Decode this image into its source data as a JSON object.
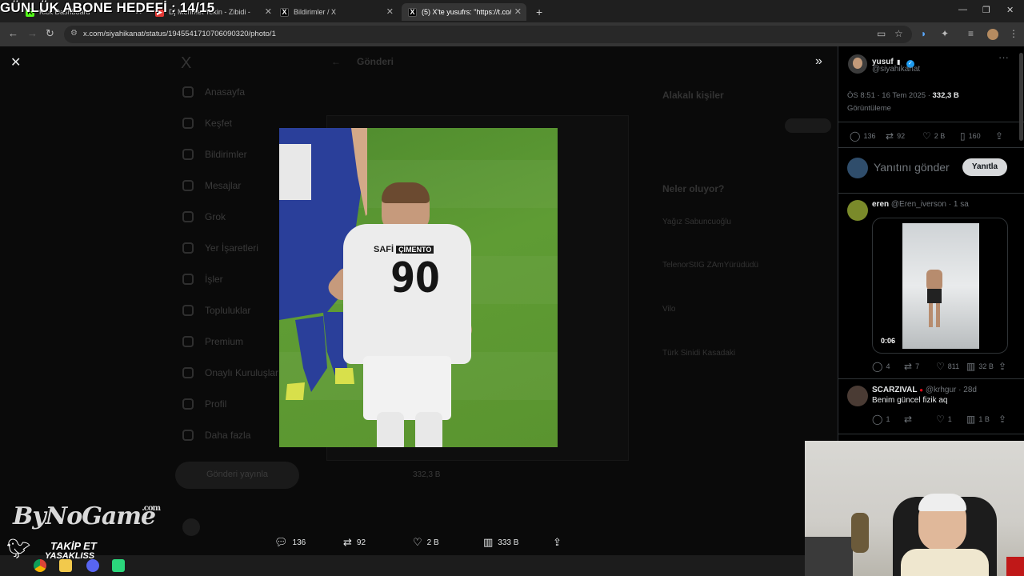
{
  "overlay": {
    "title": "GÜNLÜK ABONE HEDEFİ : 14/15",
    "brand": "ByNoGame",
    "brand_suffix": ".com",
    "follow": "TAKİP ET",
    "handle": "YASAKLISS"
  },
  "browser": {
    "tabs": [
      {
        "label": "Kick Dashboard",
        "active": false
      },
      {
        "label": "Dj Mehmet Tekin - Zibidi -",
        "active": false
      },
      {
        "label": "Bildirimler / X",
        "active": false
      },
      {
        "label": "(5) X'te yusufrs: \"https://t.co/...",
        "active": false
      }
    ],
    "url": "x.com/siyahikanat/status/1945541710706090320/photo/1"
  },
  "background_page": {
    "nav": [
      "Anasayfa",
      "Keşfet",
      "Bildirimler",
      "Mesajlar",
      "Grok",
      "Yer İşaretleri",
      "İşler",
      "Topluluklar",
      "Premium",
      "Onaylı Kuruluşlar",
      "Profil",
      "Daha fazla"
    ],
    "post_button": "Gönderi yayınla",
    "center_header": "Gönderi",
    "right_title": "Alakalı kişiler",
    "right_section": "Neler oluyor?",
    "trends": [
      "Yağız Sabuncuoğlu",
      "TelenorStIG ZAmYürüdüdü",
      "Vilo",
      "Türk Sinidi Kasadaki"
    ],
    "views_footer": "332,3 B"
  },
  "photo_actions": {
    "replies": "136",
    "reposts": "92",
    "likes": "2 B",
    "views": "333 B"
  },
  "panel": {
    "author": {
      "name": "yusuf",
      "handle": "@siyahikanat"
    },
    "timestamp": "ÖS 8:51 · 16 Tem 2025 · ",
    "views": "332,3 B",
    "views_label": "Görüntüleme",
    "stats": {
      "replies": "136",
      "reposts": "92",
      "likes": "2 B",
      "bookmarks": "160"
    },
    "reply_placeholder": "Yanıtını gönder",
    "reply_button": "Yanıtla",
    "replies": [
      {
        "name": "eren",
        "handle": "@Eren_iverson",
        "time": "1 sa",
        "video_duration": "0:06",
        "stats": {
          "replies": "4",
          "reposts": "7",
          "likes": "811",
          "views": "32 B"
        }
      },
      {
        "name": "SCARZIVAL",
        "handle": "@krhgur",
        "time": "28d",
        "text": "Benim güncel fizik aq",
        "stats": {
          "replies": "1",
          "reposts": "",
          "likes": "1",
          "views": "1 B"
        }
      }
    ]
  },
  "photo": {
    "jersey_number": "90",
    "sponsor": "SAFİ",
    "sponsor_tag": "ÇİMENTO"
  }
}
